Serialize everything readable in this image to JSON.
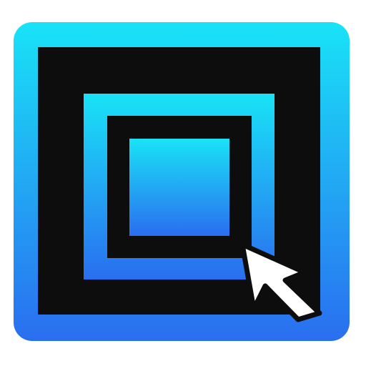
{
  "icon": {
    "name": "nested-squares-cursor-app-icon",
    "colors": {
      "gradient_top": "#19e3f6",
      "gradient_bottom": "#2a6ef0",
      "frame": "#0d0d0d",
      "cursor_fill": "#ffffff",
      "cursor_stroke": "#0d0d0d",
      "background": "#ffffff"
    },
    "cursor_icon": "mouse-pointer-arrow-icon"
  }
}
